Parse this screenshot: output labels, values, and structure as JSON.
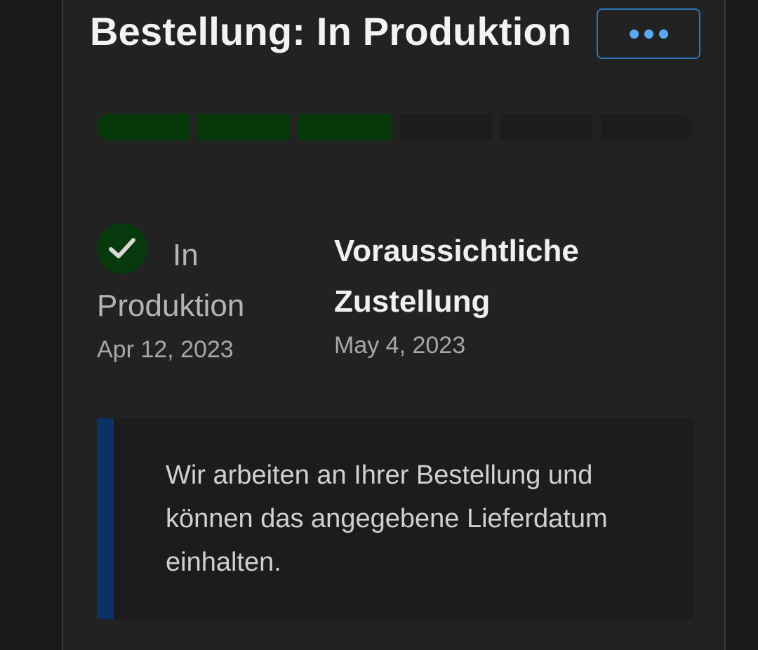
{
  "order": {
    "title": "Bestellung: In Produktion",
    "more_icon": "more-horizontal-icon"
  },
  "progress": {
    "total_steps": 6,
    "completed_steps": 3,
    "done_color": "#05390a",
    "pending_color": "#1c1c1c"
  },
  "status": {
    "icon": "check-icon",
    "label": "In Produktion",
    "date": "Apr 12, 2023"
  },
  "delivery": {
    "label": "Voraussichtliche Zustellung",
    "date": "May 4, 2023"
  },
  "note": {
    "text": "Wir arbeiten an Ihrer Bestellung und können das angegebene Lieferdatum einhalten.",
    "accent_color": "#0a3265"
  },
  "colors": {
    "button_border": "#2d74b8",
    "button_dots": "#58a9f2",
    "check_bg": "#063a0c"
  }
}
